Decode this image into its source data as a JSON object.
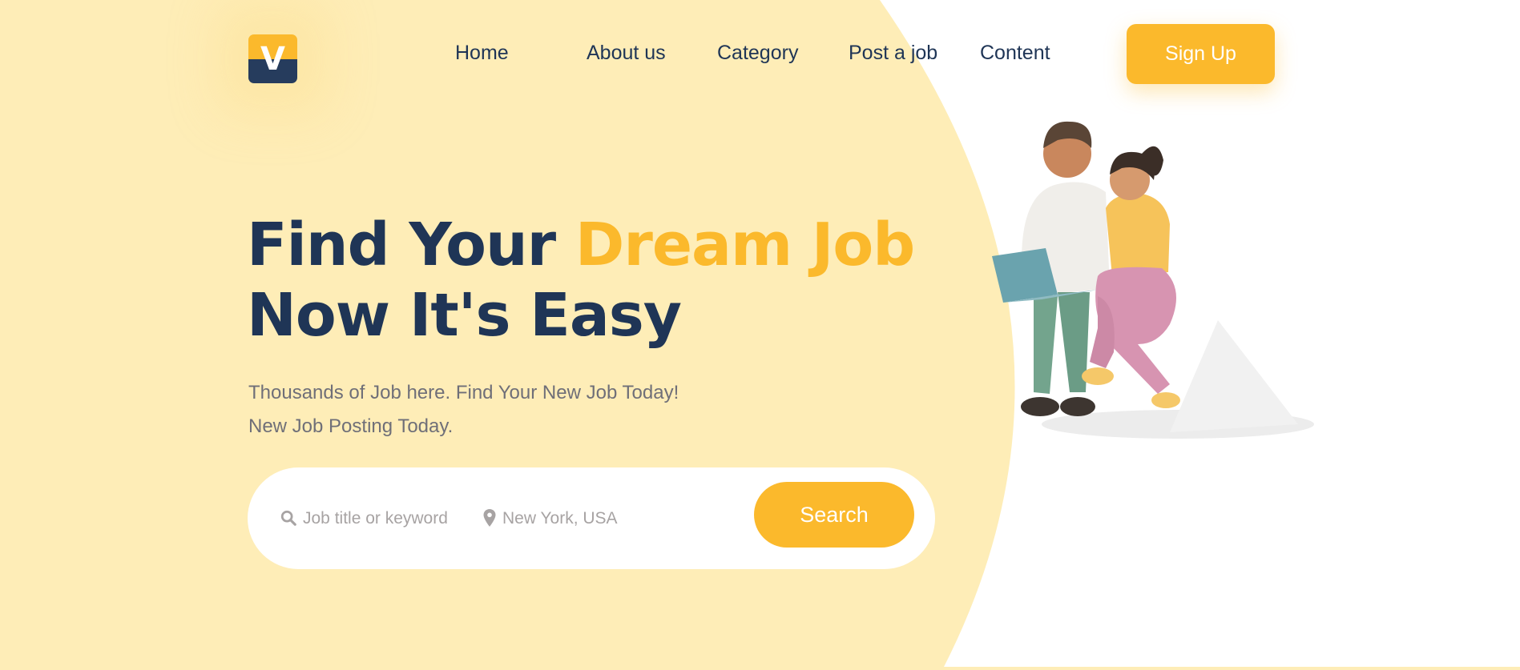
{
  "brand": {
    "logo_letter": "V"
  },
  "nav": {
    "items": [
      "Home",
      "About us",
      "Category",
      "Post a job",
      "Content"
    ]
  },
  "header": {
    "signup_label": "Sign Up"
  },
  "hero": {
    "title_part1": "Find Your ",
    "title_accent": "Dream Job",
    "title_line2": "Now It's Easy",
    "subtitle": "Thousands of Job here. Find Your New Job Today! New Job Posting Today."
  },
  "search": {
    "keyword_placeholder": "Job title or keyword",
    "location_placeholder": "New York, USA",
    "button_label": "Search"
  },
  "colors": {
    "accent": "#fbb92c",
    "navy": "#1f3556",
    "background_yellow": "#feedb7"
  },
  "icons": {
    "search": "search-icon",
    "location": "map-pin-icon"
  }
}
